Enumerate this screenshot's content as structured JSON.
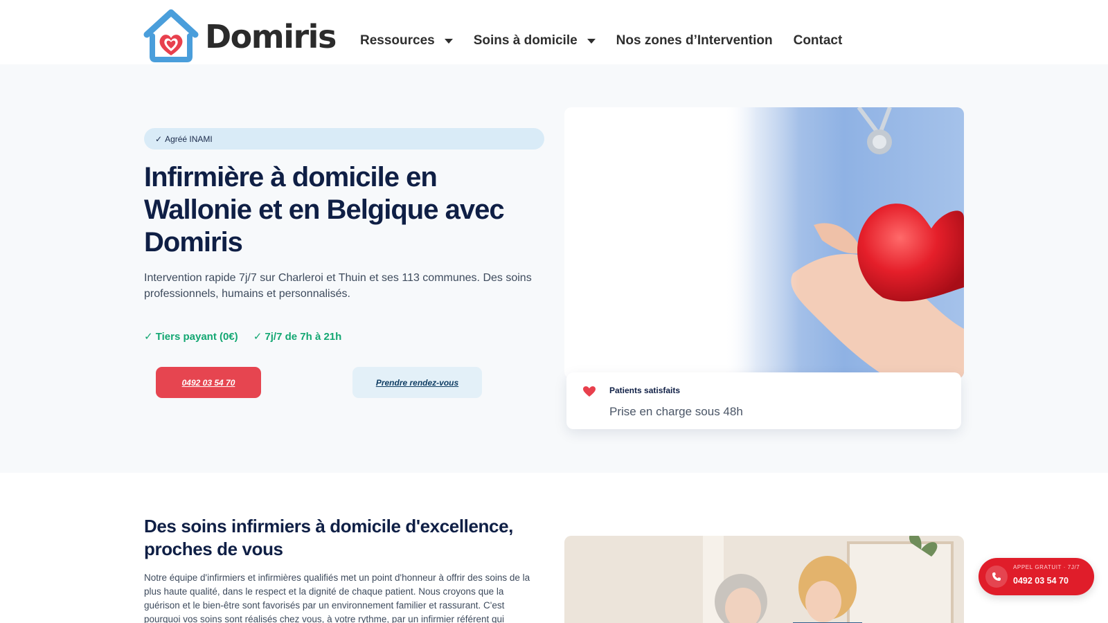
{
  "brand": {
    "name": "Domiris"
  },
  "nav": {
    "items": [
      {
        "label": "Ressources",
        "has_dropdown": true
      },
      {
        "label": "Soins à domicile",
        "has_dropdown": true
      },
      {
        "label": "Nos zones d’Intervention",
        "has_dropdown": false
      },
      {
        "label": "Contact",
        "has_dropdown": false
      }
    ]
  },
  "hero": {
    "badge": "Agréé INAMI",
    "badge_check": "✓",
    "title": "Infirmière à domicile en Wallonie et en Belgique avec Domiris",
    "description": "Intervention rapide 7j/7 sur Charleroi et Thuin et ses 113 communes. Des soins professionnels, humains et personnalisés.",
    "perks": [
      "✓ Tiers payant (0€)",
      "✓ 7j/7 de 7h à 21h"
    ],
    "phone_button": "0492 03 54 70",
    "appointment_button": "Prendre rendez-vous",
    "stat": {
      "label": "Patients satisfaits",
      "value": "Prise en charge sous 48h"
    }
  },
  "section2": {
    "title": "Des soins infirmiers à domicile d'excellence, proches de vous",
    "text": "Notre équipe d'infirmiers et infirmières qualifiés met un point d'honneur à offrir des soins de la plus haute qualité, dans le respect et la dignité de chaque patient. Nous croyons que la guérison et le bien-être sont favorisés par un environnement familier et rassurant. C'est pourquoi vos soins sont réalisés chez vous, à votre rythme, par un infirmier référent qui"
  },
  "floating_call": {
    "kicker": "APPEL GRATUIT · 7J/7",
    "number": "0492 03 54 70",
    "icon": "phone-icon"
  },
  "colors": {
    "navy": "#0f1f45",
    "red": "#e64550",
    "green": "#13a772",
    "light_blue": "#d9ebf7",
    "float_red": "#e01d2a"
  }
}
